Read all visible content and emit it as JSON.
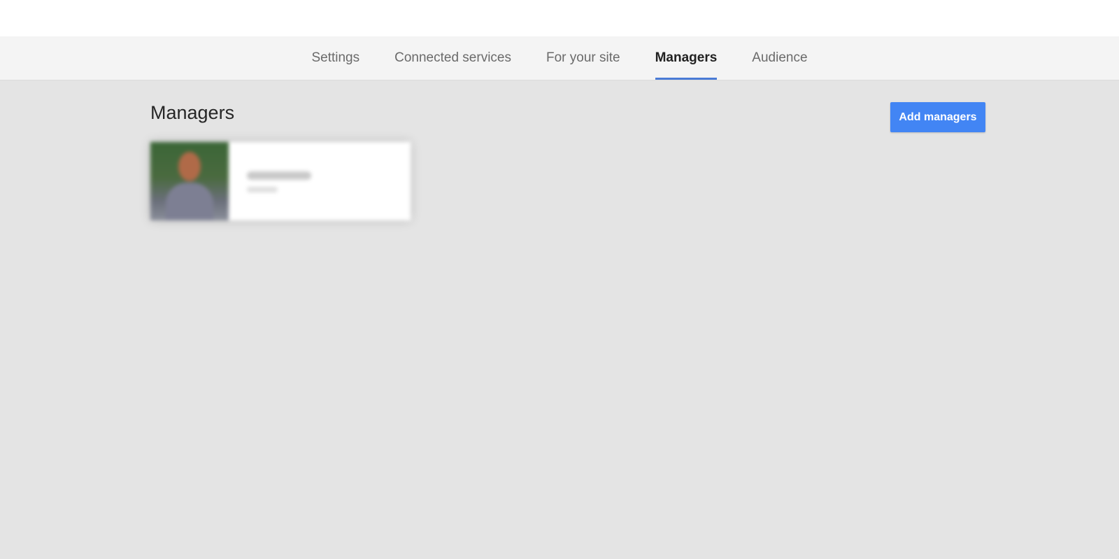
{
  "tabs": [
    {
      "label": "Settings",
      "active": false
    },
    {
      "label": "Connected services",
      "active": false
    },
    {
      "label": "For your site",
      "active": false
    },
    {
      "label": "Managers",
      "active": true
    },
    {
      "label": "Audience",
      "active": false
    }
  ],
  "main": {
    "title": "Managers",
    "add_button_label": "Add managers"
  },
  "colors": {
    "accent": "#4285f4",
    "tab_indicator": "#4a7bd6",
    "page_background": "#e4e4e4",
    "tab_bar_background": "#f4f4f4"
  },
  "icons": {
    "manager_avatar": "person-photo-blurred"
  }
}
